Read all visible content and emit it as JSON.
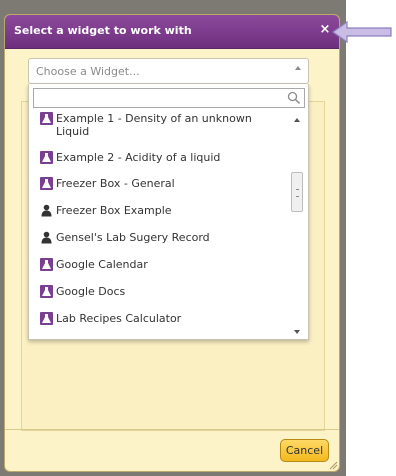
{
  "dialog": {
    "title": "Select a widget to work with",
    "close_symbol": "×",
    "cancel_label": "Cancel"
  },
  "select": {
    "placeholder": "Choose a Widget..."
  },
  "search": {
    "placeholder": "",
    "icon": "search-icon"
  },
  "items": [
    {
      "label": "Example 1 - Density of an unknown Liquid",
      "icon": "flask-icon"
    },
    {
      "label": "Example 2 - Acidity of a liquid",
      "icon": "flask-icon"
    },
    {
      "label": "Freezer Box - General",
      "icon": "flask-icon"
    },
    {
      "label": "Freezer Box Example",
      "icon": "user-icon"
    },
    {
      "label": "Gensel's Lab Sugery Record",
      "icon": "user-icon"
    },
    {
      "label": "Google Calendar",
      "icon": "flask-icon"
    },
    {
      "label": "Google Docs",
      "icon": "flask-icon"
    },
    {
      "label": "Lab Recipes Calculator",
      "icon": "flask-icon"
    }
  ],
  "colors": {
    "titlebar": "#7a3a8a",
    "dialog_bg": "#fcf3c8",
    "cancel_button": "#f5c342",
    "callout_arrow": "#b8a9d6"
  }
}
